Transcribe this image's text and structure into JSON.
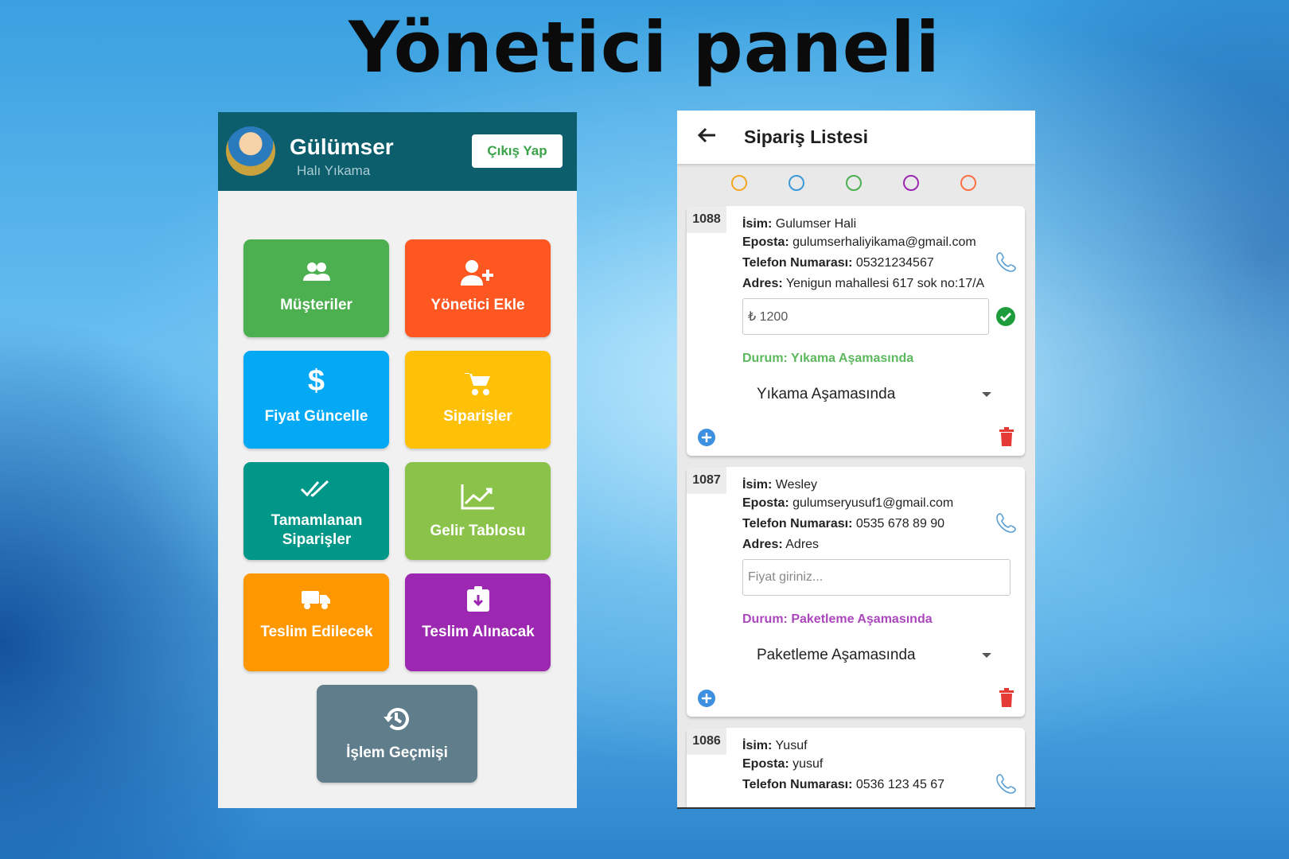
{
  "headline": "Yönetici paneli",
  "admin_panel": {
    "brand_name": "Gülümser",
    "brand_sub": "Halı Yıkama",
    "logout_label": "Çıkış Yap",
    "tiles": [
      {
        "label": "Müşteriler",
        "color": "#4caf50",
        "icon": "people-icon"
      },
      {
        "label": "Yönetici Ekle",
        "color": "#ff5722",
        "icon": "person-add-icon"
      },
      {
        "label": "Fiyat Güncelle",
        "color": "#03a9f4",
        "icon": "dollar-icon"
      },
      {
        "label": "Siparişler",
        "color": "#ffc107",
        "icon": "cart-icon"
      },
      {
        "label": "Tamamlanan Siparişler",
        "color": "#009688",
        "icon": "double-check-icon"
      },
      {
        "label": "Gelir Tablosu",
        "color": "#8bc34a",
        "icon": "trending-up-icon"
      },
      {
        "label": "Teslim Edilecek",
        "color": "#ff9800",
        "icon": "truck-icon"
      },
      {
        "label": "Teslim Alınacak",
        "color": "#9c27b0",
        "icon": "clipboard-download-icon"
      },
      {
        "label": "İşlem Geçmişi",
        "color": "#607d8b",
        "icon": "history-icon"
      }
    ]
  },
  "order_list": {
    "title": "Sipariş Listesi",
    "filter_colors": [
      "#f5a623",
      "#3a9ad9",
      "#4caf50",
      "#9c27b0",
      "#ff7043"
    ],
    "labels": {
      "name": "İsim:",
      "email": "Eposta:",
      "phone": "Telefon Numarası:",
      "address": "Adres:"
    },
    "orders": [
      {
        "id": "1088",
        "name": "Gulumser Hali",
        "email": "gulumserhaliyikama@gmail.com",
        "phone": "05321234567",
        "address": "Yenigun mahallesi 617 sok no:17/A",
        "price_value": "₺ 1200",
        "status_text": "Durum: Yıkama Aşamasında",
        "status_color": "#5cb85c",
        "status_select": "Yıkama Aşamasında"
      },
      {
        "id": "1087",
        "name": "Wesley",
        "email": "gulumseryusuf1@gmail.com",
        "phone": "0535 678 89 90",
        "address": "Adres",
        "price_placeholder": "Fiyat giriniz...",
        "status_text": "Durum: Paketleme Aşamasında",
        "status_color": "#ab47bc",
        "status_select": "Paketleme Aşamasında"
      },
      {
        "id": "1086",
        "name": "Yusuf",
        "email": "yusuf",
        "phone": "0536 123 45 67"
      }
    ]
  }
}
